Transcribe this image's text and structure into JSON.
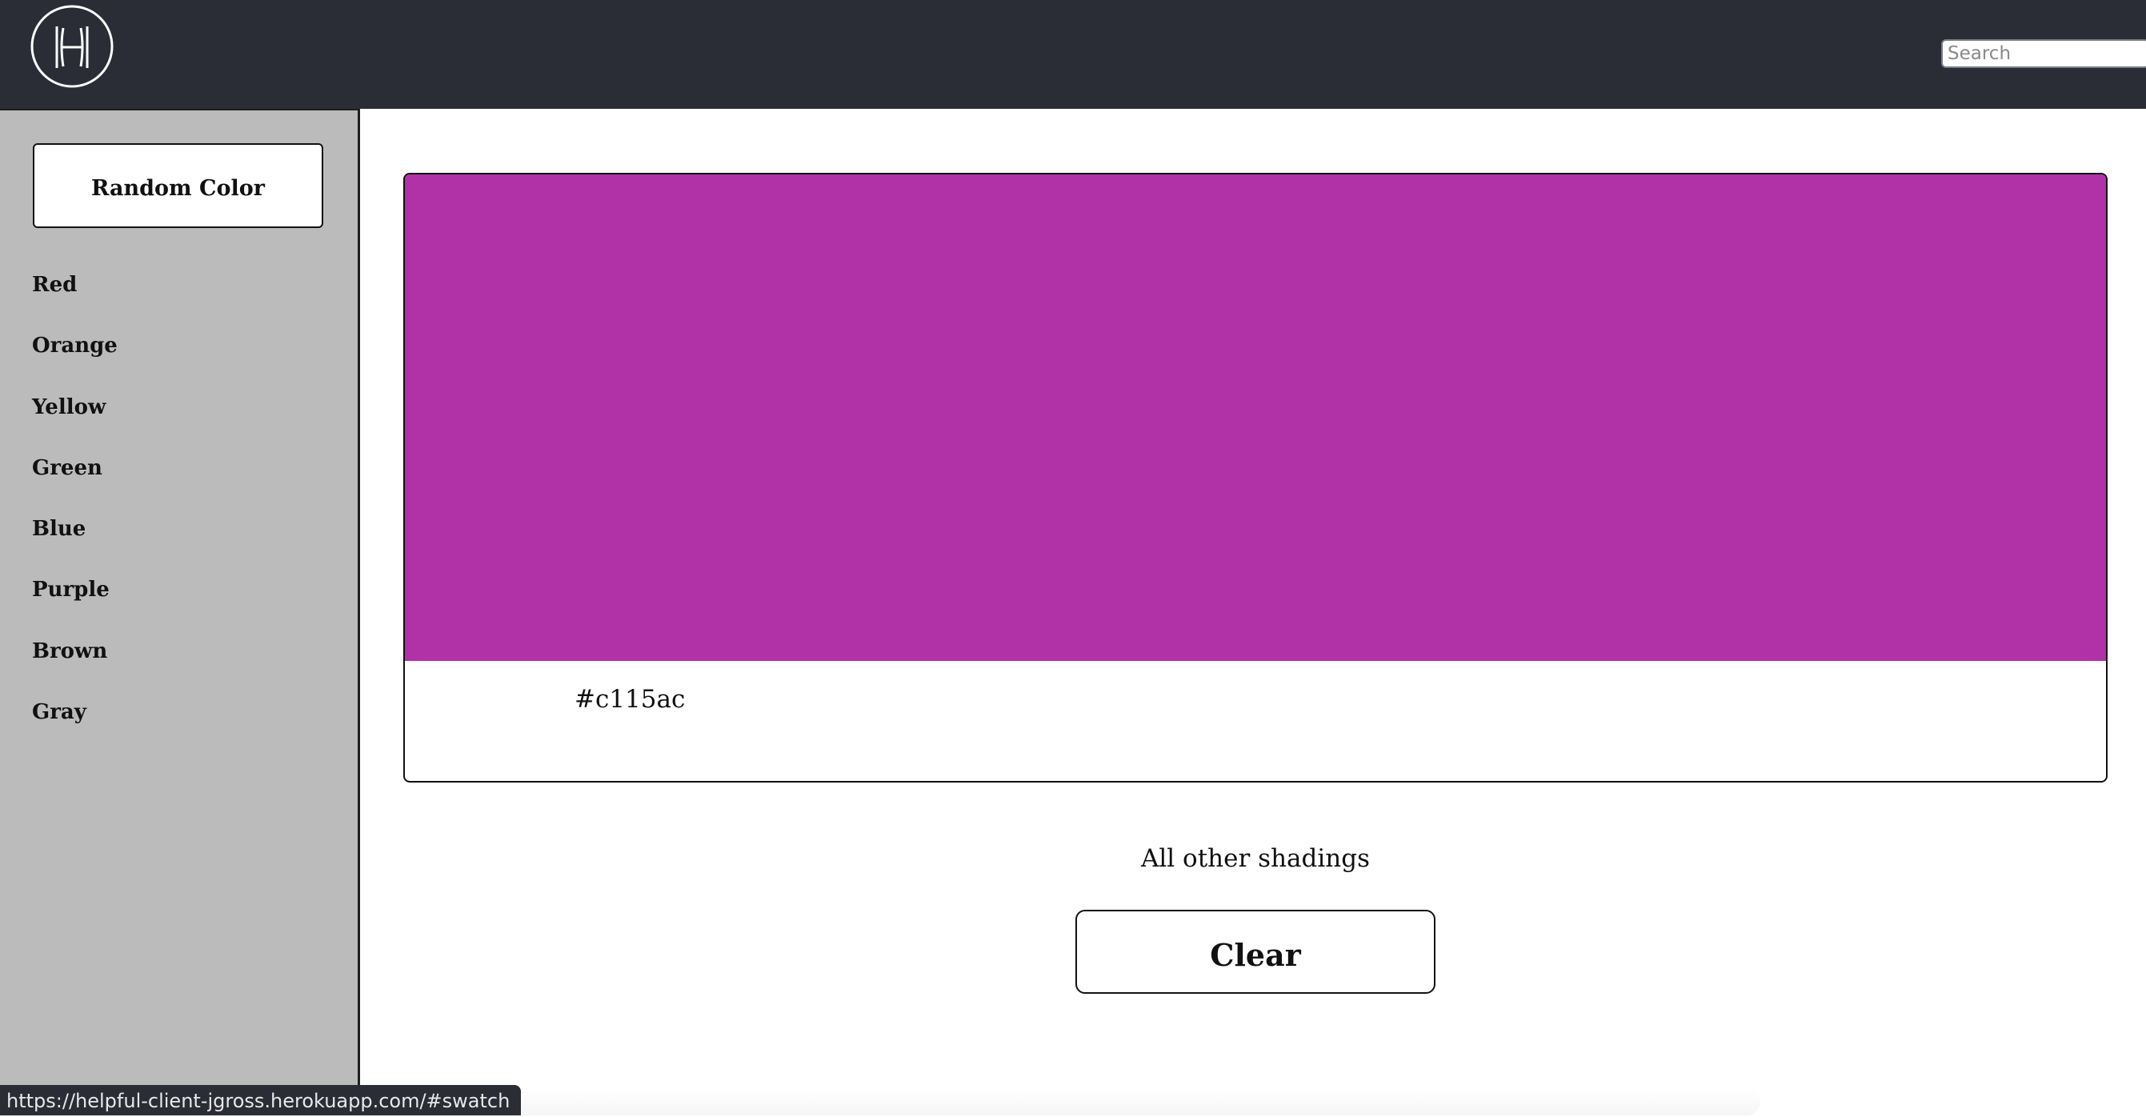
{
  "header": {
    "logo": "H",
    "search_placeholder": "Search"
  },
  "sidebar": {
    "random_button_label": "Random Color",
    "colors": [
      "Red",
      "Orange",
      "Yellow",
      "Green",
      "Blue",
      "Purple",
      "Brown",
      "Gray"
    ]
  },
  "swatch": {
    "hex_label": "#c115ac",
    "display_color": "#b131a6"
  },
  "main": {
    "shadings_label": "All other shadings",
    "clear_button_label": "Clear"
  },
  "status_bar": {
    "url": "https://helpful-client-jgross.herokuapp.com/#swatch"
  },
  "colors": {
    "header_bg": "#2a2d35",
    "sidebar_bg": "#bbbbbb"
  }
}
